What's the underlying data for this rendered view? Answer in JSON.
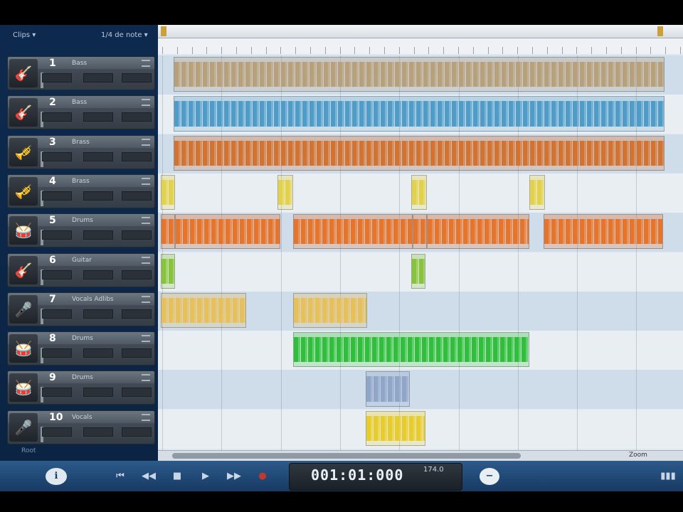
{
  "left_panel": {
    "view_dropdown": "Clips",
    "snap_dropdown": "1/4 de note",
    "footer_label": "Root"
  },
  "tracks": [
    {
      "number": "1",
      "name": "Bass",
      "icon": "bass-guitar-icon"
    },
    {
      "number": "2",
      "name": "Bass",
      "icon": "bass-guitar-icon"
    },
    {
      "number": "3",
      "name": "Brass",
      "icon": "brass-icon"
    },
    {
      "number": "4",
      "name": "Brass",
      "icon": "brass-icon"
    },
    {
      "number": "5",
      "name": "Drums",
      "icon": "drum-icon"
    },
    {
      "number": "6",
      "name": "Guitar",
      "icon": "guitar-icon"
    },
    {
      "number": "7",
      "name": "Vocals Adlibs",
      "icon": "microphone-icon"
    },
    {
      "number": "8",
      "name": "Drums",
      "icon": "drum-icon"
    },
    {
      "number": "9",
      "name": "Drums",
      "icon": "drum-icon"
    },
    {
      "number": "10",
      "name": "Vocals",
      "icon": "microphone-icon"
    }
  ],
  "transport": {
    "position": "001:01:000",
    "tempo": "174.0",
    "zoom_label": "Zoom"
  },
  "colors": {
    "track1": "#b8a07a",
    "track2": "#4f9cc9",
    "track3": "#d4722f",
    "track4": "#e3d14a",
    "track5": "#e8742a",
    "track6": "#88c43a",
    "track7": "#e8c05a",
    "track8": "#2fbf3a",
    "track9": "#8fa6c8",
    "track10": "#e8cc2a"
  }
}
